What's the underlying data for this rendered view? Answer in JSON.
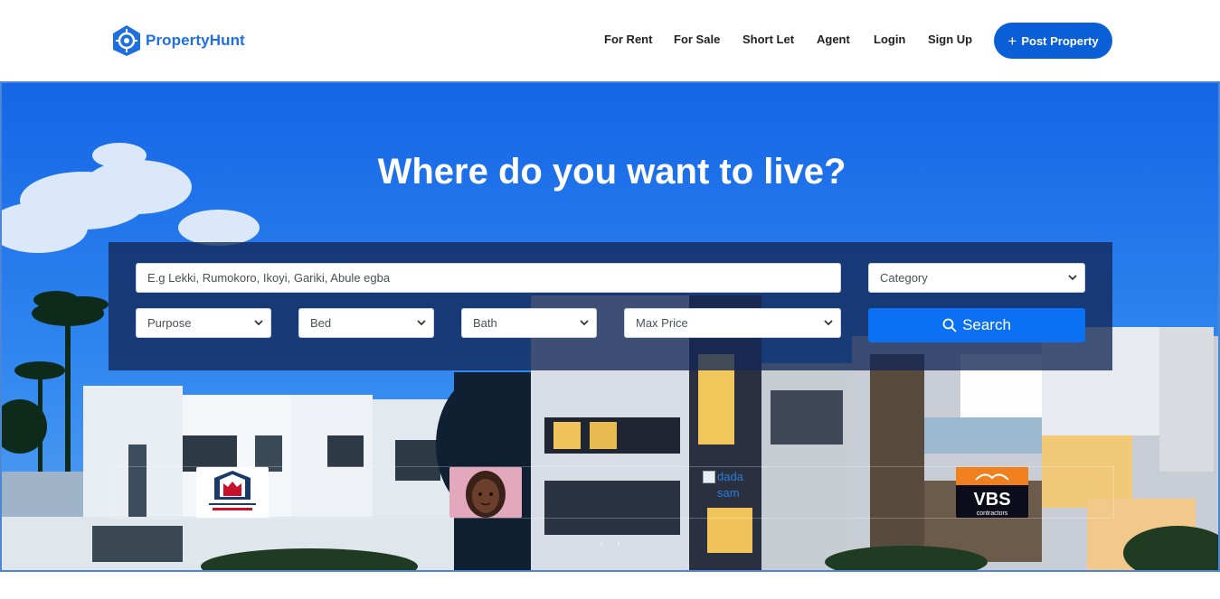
{
  "brand": {
    "name": "PropertyHunt"
  },
  "nav": {
    "links": [
      {
        "label": "For Rent"
      },
      {
        "label": "For Sale"
      },
      {
        "label": "Short Let"
      },
      {
        "label": "Agent"
      },
      {
        "label": "Login"
      },
      {
        "label": "Sign Up"
      }
    ],
    "post_property_label": "Post Property"
  },
  "hero": {
    "title": "Where do you want to live?",
    "search": {
      "location_placeholder": "E.g Lekki, Rumokoro, Ikoyi, Gariki, Abule egba",
      "category_selected": "Category",
      "purpose_selected": "Purpose",
      "bed_selected": "Bed",
      "bath_selected": "Bath",
      "max_price_selected": "Max Price",
      "search_label": "Search"
    }
  },
  "agents_carousel": {
    "broken_image_alt": "dada sam",
    "vbs_logo_text": "VBS",
    "vbs_logo_sub": "contractors",
    "controls": "‹ ›"
  },
  "colors": {
    "primary": "#0a5fd6",
    "brand_blue": "#1e6fe0",
    "search_button": "#0c70f2",
    "sky": "#1a6fe8"
  },
  "icons": {
    "logo": "map-pin-target-icon",
    "plus": "plus-icon",
    "search": "magnifier-icon",
    "select_arrow": "chevron-down-icon"
  }
}
